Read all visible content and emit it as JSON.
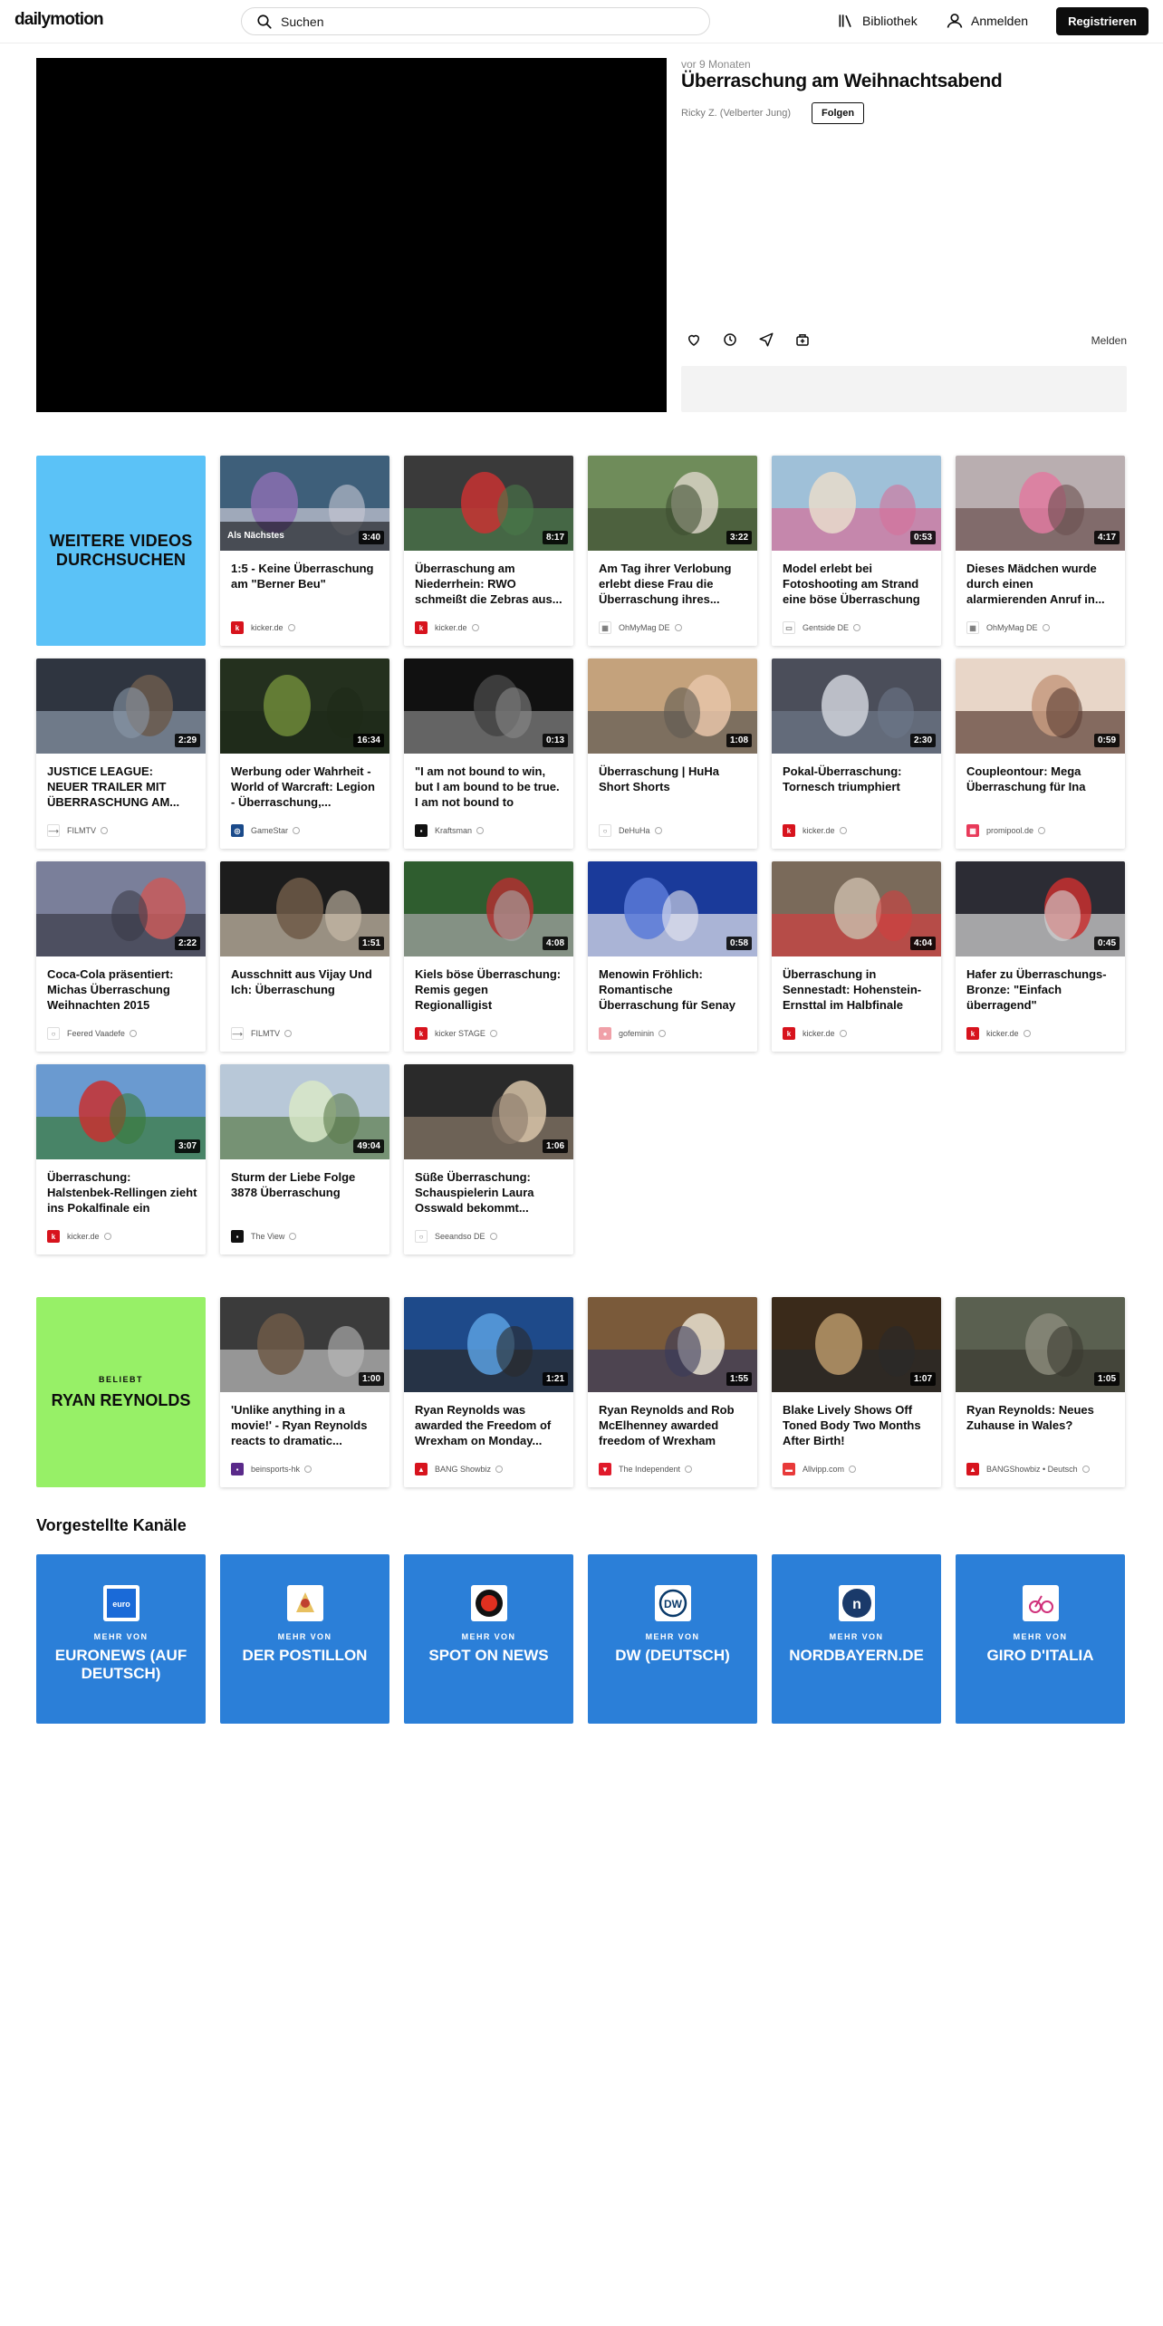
{
  "header": {
    "logo": "dailymotion",
    "search_placeholder": "Suchen",
    "library": "Bibliothek",
    "login": "Anmelden",
    "register": "Registrieren"
  },
  "video": {
    "time_ago": "vor 9 Monaten",
    "title": "Überraschung am Weihnachtsabend",
    "channel": "Ricky Z. (Velberter Jung)",
    "follow": "Folgen",
    "report": "Melden"
  },
  "browse_promo": "WEITERE VIDEOS DURCHSUCHEN",
  "up_next_label": "Als Nächstes",
  "related": [
    {
      "title": "1:5 - Keine Überraschung am \"Berner Beu\"",
      "channel": "kicker.de",
      "duration": "3:40",
      "logo": "kicker"
    },
    {
      "title": "Überraschung am Niederrhein: RWO schmeißt die Zebras aus...",
      "channel": "kicker.de",
      "duration": "8:17",
      "logo": "kicker"
    },
    {
      "title": "Am Tag ihrer Verlobung erlebt diese Frau die Überraschung ihres...",
      "channel": "OhMyMag DE",
      "duration": "3:22",
      "logo": "ohmymag"
    },
    {
      "title": "Model erlebt bei Fotoshooting am Strand eine böse Überraschung",
      "channel": "Gentside DE",
      "duration": "0:53",
      "logo": "gentside"
    },
    {
      "title": "Dieses Mädchen wurde durch einen alarmierenden Anruf in...",
      "channel": "OhMyMag DE",
      "duration": "4:17",
      "logo": "ohmymag"
    },
    {
      "title": "JUSTICE LEAGUE: NEUER TRAILER MIT ÜBERRASCHUNG AM...",
      "channel": "FILMTV",
      "duration": "2:29",
      "logo": "filmtv"
    },
    {
      "title": "Werbung oder Wahrheit - World of Warcraft: Legion - Überraschung,...",
      "channel": "GameStar",
      "duration": "16:34",
      "logo": "gamestar"
    },
    {
      "title": "\"I am not bound to win, but I am bound to be true. I am not bound to succee...",
      "channel": "Kraftsman",
      "duration": "0:13",
      "logo": "kraftsman"
    },
    {
      "title": "Überraschung | HuHa Short Shorts",
      "channel": "DeHuHa",
      "duration": "1:08",
      "logo": "person"
    },
    {
      "title": "Pokal-Überraschung: Tornesch triumphiert",
      "channel": "kicker.de",
      "duration": "2:30",
      "logo": "kicker"
    },
    {
      "title": "Coupleontour: Mega Überraschung für Ina",
      "channel": "promipool.de",
      "duration": "0:59",
      "logo": "promipool"
    },
    {
      "title": "Coca-Cola präsentiert: Michas Überraschung Weihnachten 2015",
      "channel": "Feered Vaadefe",
      "duration": "2:22",
      "logo": "person"
    },
    {
      "title": "Ausschnitt aus Vijay Und Ich: Überraschung",
      "channel": "FILMTV",
      "duration": "1:51",
      "logo": "filmtv"
    },
    {
      "title": "Kiels böse Überraschung: Remis gegen Regionalligist",
      "channel": "kicker STAGE",
      "duration": "4:08",
      "logo": "kicker"
    },
    {
      "title": "Menowin Fröhlich: Romantische Überraschung für Senay",
      "channel": "gofeminin",
      "duration": "0:58",
      "logo": "gofeminin"
    },
    {
      "title": "Überraschung in Sennestadt: Hohenstein-Ernsttal im Halbfinale",
      "channel": "kicker.de",
      "duration": "4:04",
      "logo": "kicker"
    },
    {
      "title": "Hafer zu Überraschungs-Bronze: \"Einfach überragend\"",
      "channel": "kicker.de",
      "duration": "0:45",
      "logo": "kicker"
    },
    {
      "title": "Überraschung: Halstenbek-Rellingen zieht ins Pokalfinale ein",
      "channel": "kicker.de",
      "duration": "3:07",
      "logo": "kicker"
    },
    {
      "title": "Sturm der Liebe Folge 3878 Überraschung",
      "channel": "The View",
      "duration": "49:04",
      "logo": "theview"
    },
    {
      "title": "Süße Überraschung: Schauspielerin Laura Osswald bekommt...",
      "channel": "Seeandso DE",
      "duration": "1:06",
      "logo": "person"
    }
  ],
  "popular": {
    "label": "BELIEBT",
    "topic": "RYAN REYNOLDS",
    "videos": [
      {
        "title": "'Unlike anything in a movie!' - Ryan Reynolds reacts to dramatic...",
        "channel": "beinsports-hk",
        "duration": "1:00",
        "logo": "bein"
      },
      {
        "title": "Ryan Reynolds was awarded the Freedom of Wrexham on Monday...",
        "channel": "BANG Showbiz",
        "duration": "1:21",
        "logo": "bang"
      },
      {
        "title": "Ryan Reynolds and Rob McElhenney awarded freedom of Wrexham",
        "channel": "The Independent",
        "duration": "1:55",
        "logo": "independent"
      },
      {
        "title": "Blake Lively Shows Off Toned Body Two Months After Birth!",
        "channel": "Allvipp.com",
        "duration": "1:07",
        "logo": "allvipp"
      },
      {
        "title": "Ryan Reynolds: Neues Zuhause in Wales?",
        "channel": "BANGShowbiz • Deutsch",
        "duration": "1:05",
        "logo": "bang"
      }
    ]
  },
  "featured": {
    "title": "Vorgestellte Kanäle",
    "more_label": "MEHR VON",
    "channels": [
      {
        "name": "EURONEWS (AUF DEUTSCH)",
        "logo": "euronews"
      },
      {
        "name": "DER POSTILLON",
        "logo": "postillon"
      },
      {
        "name": "SPOT ON NEWS",
        "logo": "spoton"
      },
      {
        "name": "DW (DEUTSCH)",
        "logo": "dw"
      },
      {
        "name": "NORDBAYERN.DE",
        "logo": "nordbayern"
      },
      {
        "name": "GIRO D'ITALIA",
        "logo": "giro"
      }
    ]
  },
  "colors": {
    "browse_promo": "#5bc2f7",
    "popular_promo": "#97f067",
    "channel_card": "#2b7fd8",
    "kicker_red": "#d7131d"
  }
}
